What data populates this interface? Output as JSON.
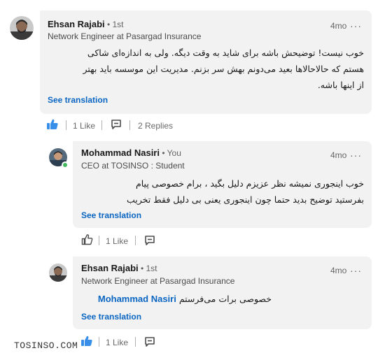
{
  "comments": [
    {
      "author": "Ehsan Rajabi",
      "degree": " • 1st",
      "headline": "Network Engineer at Pasargad Insurance",
      "time": "4mo",
      "text_lines": [
        "خوب نیست! توضیحش باشه برای شاید به وقت دیگه. ولی به اندازه‌ای شاکی",
        "هستم که حالاحالاها بعید می‌دونم بهش سر بزنم. مدیریت این موسسه باید بهتر",
        "از اینها باشه."
      ],
      "see_translation": "See translation",
      "likes": "1 Like",
      "replies": "2 Replies"
    },
    {
      "author": "Mohammad Nasiri",
      "degree": " • You",
      "headline": "CEO at TOSINSO : Student",
      "time": "4mo",
      "text_lines": [
        "خوب اینجوری نمیشه نظر عزیزم دلیل بگید ، برام خصوصی پیام",
        "بفرستید توضیح بدید حتما چون اینجوری یعنی بی دلیل فقط تخریب"
      ],
      "see_translation": "See translation",
      "likes": "1 Like"
    },
    {
      "author": "Ehsan Rajabi",
      "degree": " • 1st",
      "headline": "Network Engineer at Pasargad Insurance",
      "time": "4mo",
      "mention": "Mohammad Nasiri",
      "text": "خصوصی برات می‌فرستم",
      "see_translation": "See translation",
      "likes": "1 Like"
    }
  ],
  "watermark": "TOSINSO.COM",
  "more_label": "···",
  "colors": {
    "link": "#0a66c2",
    "bubble": "#f2f2f2",
    "presence": "#44b85f"
  },
  "icons": {
    "like_filled": "thumbs-up-filled-icon",
    "like_outline": "thumbs-up-outline-icon",
    "reply": "comment-reply-icon",
    "more": "ellipsis-icon"
  }
}
